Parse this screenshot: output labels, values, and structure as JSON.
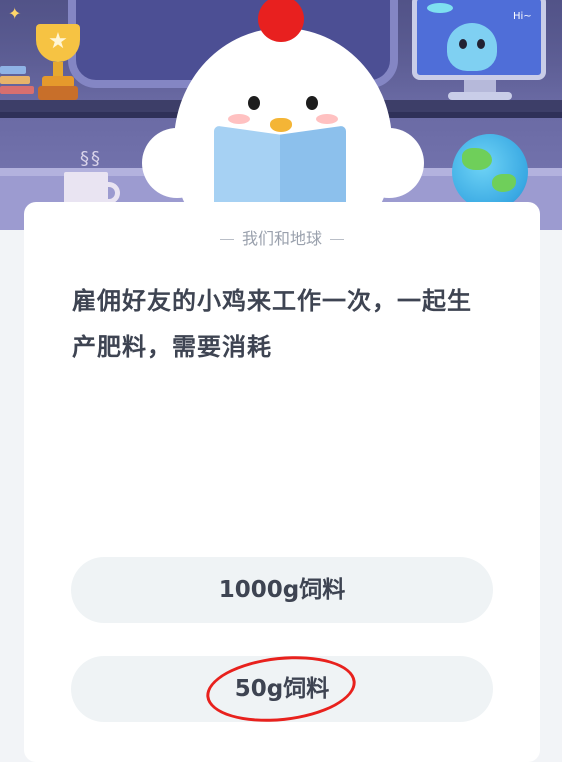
{
  "header": {
    "monitor_text": "Hi~"
  },
  "card": {
    "category": "我们和地球",
    "question": "雇佣好友的小鸡来工作一次，一起生产肥料，需要消耗",
    "options": [
      {
        "label": "1000g饲料"
      },
      {
        "label": "50g饲料",
        "marked": true
      }
    ]
  },
  "colors": {
    "card_bg": "#ffffff",
    "option_bg": "#eff3f5",
    "text_primary": "#3e4452",
    "text_muted": "#9aa1ad",
    "hand_circle": "#e8211d"
  }
}
